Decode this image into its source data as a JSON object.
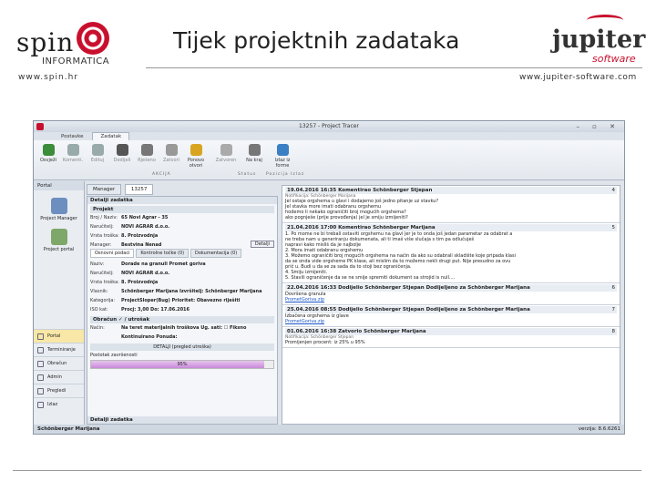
{
  "header": {
    "title": "Tijek projektnih zadataka",
    "spin_word": "spin",
    "spin_sub": "INFORMATICA",
    "spin_url": "www.spin.hr",
    "jupiter_word": "jupiter",
    "jupiter_sub": "software",
    "jupiter_url": "www.jupiter-software.com"
  },
  "app": {
    "window_title": "13257 - Project Tracer",
    "window_controls": "– ▫ ✕",
    "tabs": [
      "Postavke",
      "Zadatak"
    ],
    "ribbon": [
      {
        "label": "Osvježi",
        "icon": "refresh-icon",
        "disabled": false
      },
      {
        "label": "Komenti.",
        "icon": "comment-icon",
        "disabled": true
      },
      {
        "label": "Edituj",
        "icon": "edit-icon",
        "disabled": true
      },
      {
        "label": "Dodijeli",
        "icon": "assign-icon",
        "disabled": true
      },
      {
        "label": "Rješeno",
        "icon": "check-icon",
        "disabled": true
      },
      {
        "label": "Zatvori",
        "icon": "close-doc-icon",
        "disabled": true
      },
      {
        "label": "Ponovo otvori",
        "icon": "folder-open-icon",
        "disabled": false
      },
      {
        "label": "Zatvoren",
        "icon": "status-icon",
        "disabled": true
      },
      {
        "label": "Na kraj",
        "icon": "arrow-down-icon",
        "disabled": false
      },
      {
        "label": "Izlaz iz forme",
        "icon": "exit-icon",
        "disabled": false
      }
    ],
    "ribbon_groups": [
      "AKCIJA",
      "Status",
      "Pozicija",
      "Izlaz"
    ],
    "left_nav": {
      "header": "Portal",
      "buttons": [
        "Project Manager",
        "Project portal"
      ],
      "items": [
        "Portal",
        "Terminiranje",
        "Obračun",
        "Admin",
        "Pregledi",
        "Izlaz"
      ]
    },
    "doc_tabs": [
      "Manager",
      "13257"
    ],
    "details": {
      "header": "Detalji zadatka",
      "project_header": "Projekt",
      "project_rows": [
        {
          "label": "Broj / Naziv:",
          "value": "65        Novi Agrar - 35"
        },
        {
          "label": "Naručitelj:",
          "value": "NOVI AGRAR d.o.o."
        },
        {
          "label": "Vrsta troška:",
          "value": "8. Proizvodnja"
        },
        {
          "label": "Manager:",
          "value": "Bestvina Nenad"
        }
      ],
      "details_button": "Detalji",
      "subtabs": [
        "Osnovni podaci",
        "Kontrolne točke (0)",
        "Dokumentacija (0)"
      ],
      "task_rows": [
        {
          "label": "Naziv:",
          "value": "Dorade na granuli Promet goriva"
        },
        {
          "label": "Naručitelj:",
          "value": "NOVI AGRAR d.o.o."
        },
        {
          "label": "Vrsta troška:",
          "value": "8. Proizvodnja"
        },
        {
          "label": "Vlasnik:",
          "value": "Schönberger Marijana   Izvršitelj: Schönberger Marijana"
        },
        {
          "label": "Kategorija:",
          "value": "ProjectSloper(Bug)   Prioritet: Obavezno riješiti"
        },
        {
          "label": "ISO kat:",
          "value": "Procj:  3,00   Do: 17.06.2016"
        }
      ],
      "billing_header": "Obračun  ✓  / utrošak",
      "billing_rows": [
        {
          "label": "Način:",
          "value": "Na teret materijalnih troškova   Ug. sati:   ☐ Fiksno"
        },
        {
          "label": "",
          "value": "Kontinuirano   Ponuda:"
        }
      ],
      "details_bar": "DETALJI (pregled utroška)",
      "completion_label": "Postotak završenosti",
      "completion_pct": 95,
      "completion_text": "95%",
      "footer": "Detalji zadatka"
    },
    "history": [
      {
        "head": "19.04.2016 16:35  Komentirao  Schönberger Stjepan",
        "num": "4",
        "note": "Notifikacija: Schönberger Marijana",
        "text": "Jel ostaje orgshema u glavi i dodajemo još jedno pitanje uz stavku?\nJel stavka more imati odabranu orgshemu\nhodemo li nekako ograničiti broj mogućih orgshema?\nako pognješe (prije provođenja) jel je smiju izmijeniti?",
        "attach": ""
      },
      {
        "head": "21.04.2016 17:00  Komentirao  Schönberger Marijana",
        "num": "5",
        "note": "",
        "text": "1. Po mome ne bi trebali ostaviti orgshemu na glavi jer je to onda još jedan parametar za odabrat a\nne treba nam u generiranju dokumenata, ali ti imaš više slučaja s tim pa odlučuješ\nnapravi kako misliš da je najbolje\n2. Mora imati odabranu orgshemu\n3. Možemo ograničiti broj mogućih orgshema na način da ako su odabrali skladište koje pripada klasi\nda se onda vide orgsheme PK klase, ali mislim da to možemo nekli drugi put. Nije presudno za ovu\nprič u. Budi u da se za sada da to stoji bez ograničenja.\n4. Smiju izmijeniti.\n5. Stavili ograničenje da se ne smije spremiti dokument sa strojid is null....",
        "attach": ""
      },
      {
        "head": "22.04.2016 16:33  Dodijelio  Schönberger Stjepan  Dodijeljeno za  Schönberger Marijana",
        "num": "6",
        "note": "",
        "text": "Dovršena granula",
        "attach": "PrometGoriva.zip"
      },
      {
        "head": "25.04.2016 08:55  Dodijelio  Schönberger Stjepan  Dodijeljeno za  Schönberger Marijana",
        "num": "7",
        "note": "",
        "text": "Izbačena orgshema iz glave",
        "attach": "PrometGoriva.zip"
      },
      {
        "head": "01.06.2016 16:38  Zatvorio  Schönberger Marijana",
        "num": "8",
        "note": "Notifikacija: Schönberger Stjepan",
        "text": "Promijenjen procent: iz 25% u 95%",
        "attach": ""
      }
    ],
    "status_user": "Schönberger Marijana",
    "status_version": "verzija: 8.6.6261"
  }
}
